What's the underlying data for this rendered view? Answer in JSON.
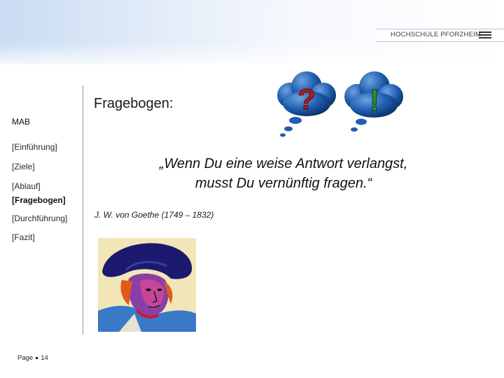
{
  "header": {
    "logo_text": "HOCHSCHULE PFORZHEIM"
  },
  "slide": {
    "title": "Fragebogen:",
    "quote_line1": "„Wenn Du eine weise Antwort verlangst,",
    "quote_line2": "musst Du vernünftig fragen.“",
    "attribution": "J. W. von Goethe (1749 – 1832)",
    "bubble_question": "?",
    "bubble_exclamation": "!"
  },
  "sidebar": {
    "section": "MAB",
    "items": [
      {
        "label": "[Einführung]",
        "active": false
      },
      {
        "label": "[Ziele]",
        "active": false
      },
      {
        "label": "[Ablauf]",
        "active": false
      },
      {
        "label": "[Fragebogen]",
        "active": true
      },
      {
        "label": "[Durchführung]",
        "active": false
      },
      {
        "label": "[Fazit]",
        "active": false
      }
    ]
  },
  "footer": {
    "page_label": "Page",
    "page_number": "14"
  },
  "colors": {
    "bubble_blue": "#1f5fb0",
    "question_red": "#b01c1c",
    "exclamation_green": "#2f8b2f",
    "header_blue": "#c9dcf2"
  },
  "images": {
    "bubbles": "question-exclamation-bubbles",
    "portrait": "goethe-pop-art-portrait"
  }
}
